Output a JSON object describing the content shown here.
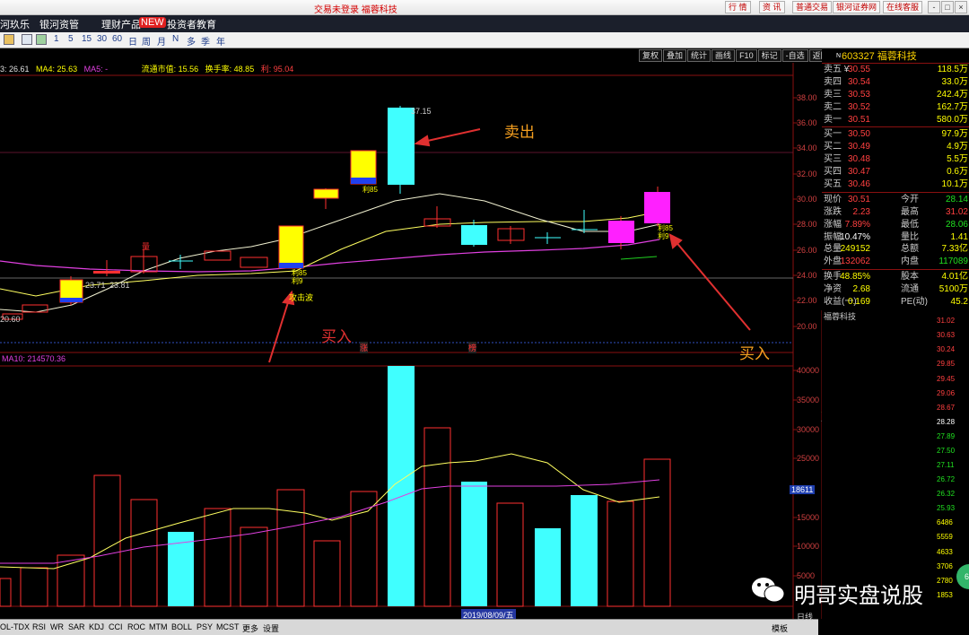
{
  "titlebar": {
    "center": "交易未登录   福蓉科技",
    "buttons": [
      "行 情",
      "资 讯",
      "普通交易",
      "银河证券网",
      "在线客服"
    ],
    "win": [
      "-",
      "□",
      "×"
    ]
  },
  "menu": [
    "河玖乐",
    "银河资管",
    "理财产品",
    "投资者教育"
  ],
  "menu_badge": "NEW",
  "toolbar": [
    "1",
    "5",
    "15",
    "30",
    "60",
    "日",
    "周",
    "月",
    "N",
    "多",
    "季",
    "年"
  ],
  "chartbar": {
    "ma3": "3: 26.61",
    "ma4": "MA4: 25.63",
    "ma5": "MA5: -",
    "float_cap": "流通市值: 15.56",
    "turnover": "换手率: 48.85",
    "profit": "利: 95.04"
  },
  "funcbar": [
    "复权",
    "叠加",
    "统计",
    "画线",
    "F10",
    "标记",
    "-自选",
    "返回"
  ],
  "price_axis": [
    "38.00",
    "36.00",
    "34.00",
    "32.00",
    "30.00",
    "28.00",
    "26.00",
    "24.00",
    "22.00",
    "20.00"
  ],
  "vol_axis": [
    "40000",
    "35000",
    "30000",
    "25000",
    "20000",
    "15000",
    "10000",
    "5000"
  ],
  "vol_highlight": "18611",
  "vol_ma_text": "MA10: 214570.36",
  "chart_labels": {
    "high": "37.15",
    "low1": "23.71",
    "low2": "23.81",
    "bottom": "20.60",
    "up_mark": "涨",
    "rank_mark": "榜",
    "ma_mark": "量",
    "attack": "攻击波",
    "p85a": "利85",
    "p85b": "利85",
    "p85c": "利85",
    "p9a": "利9",
    "p9b": "利9",
    "buy1": "买入",
    "sell": "卖出",
    "buy2": "买入"
  },
  "date_label": "2019/08/09/五",
  "quote": {
    "n": "N",
    "code": "603327",
    "name": "福蓉科技",
    "asks": [
      {
        "label": "卖五 ¥",
        "price": "30.55",
        "vol": "118.5万"
      },
      {
        "label": "卖四",
        "price": "30.54",
        "vol": "33.0万"
      },
      {
        "label": "卖三",
        "price": "30.53",
        "vol": "242.4万"
      },
      {
        "label": "卖二",
        "price": "30.52",
        "vol": "162.7万"
      },
      {
        "label": "卖一",
        "price": "30.51",
        "vol": "580.0万"
      }
    ],
    "bids": [
      {
        "label": "买一",
        "price": "30.50",
        "vol": "97.9万"
      },
      {
        "label": "买二",
        "price": "30.49",
        "vol": "4.9万"
      },
      {
        "label": "买三",
        "price": "30.48",
        "vol": "5.5万"
      },
      {
        "label": "买四",
        "price": "30.47",
        "vol": "0.6万"
      },
      {
        "label": "买五",
        "price": "30.46",
        "vol": "10.1万"
      }
    ],
    "stats": [
      {
        "k1": "现价",
        "v1": "30.51",
        "k2": "今开",
        "v2": "28.14"
      },
      {
        "k1": "涨跌",
        "v1": "2.23",
        "k2": "最高",
        "v2": "31.02"
      },
      {
        "k1": "涨幅",
        "v1": "7.89%",
        "k2": "最低",
        "v2": "28.06"
      },
      {
        "k1": "振幅",
        "v1": "10.47%",
        "k2": "量比",
        "v2": "1.41"
      },
      {
        "k1": "总量",
        "v1": "249152",
        "k2": "总额",
        "v2": "7.33亿"
      },
      {
        "k1": "外盘",
        "v1": "132062",
        "k2": "内盘",
        "v2": "117089"
      }
    ],
    "stats2": [
      {
        "k1": "换手",
        "v1": "48.85%",
        "k2": "股本",
        "v2": "4.01亿"
      },
      {
        "k1": "净资",
        "v1": "2.68",
        "k2": "流通",
        "v2": "5100万"
      },
      {
        "k1": "收益(一)",
        "v1": "0.169",
        "k2": "PE(动)",
        "v2": "45.2"
      }
    ]
  },
  "mini": {
    "title": "福蓉科技",
    "price_axis": [
      "31.02",
      "30.63",
      "30.24",
      "29.85",
      "29.45",
      "29.06",
      "28.67",
      "28.28",
      "27.89",
      "27.50",
      "27.11",
      "26.72",
      "26.32",
      "25.93"
    ],
    "vol_axis": [
      "6486",
      "5559",
      "4633",
      "3706",
      "2780",
      "1853"
    ]
  },
  "bottom_tabs": [
    "OL-TDX",
    "RSI",
    "WR",
    "SAR",
    "KDJ",
    "CCI",
    "ROC",
    "MTM",
    "BOLL",
    "PSY",
    "MCST",
    "更多",
    "设置"
  ],
  "bottom_right": [
    "模板",
    "日线"
  ],
  "watermark": "明哥实盘说股",
  "badge": "60"
}
